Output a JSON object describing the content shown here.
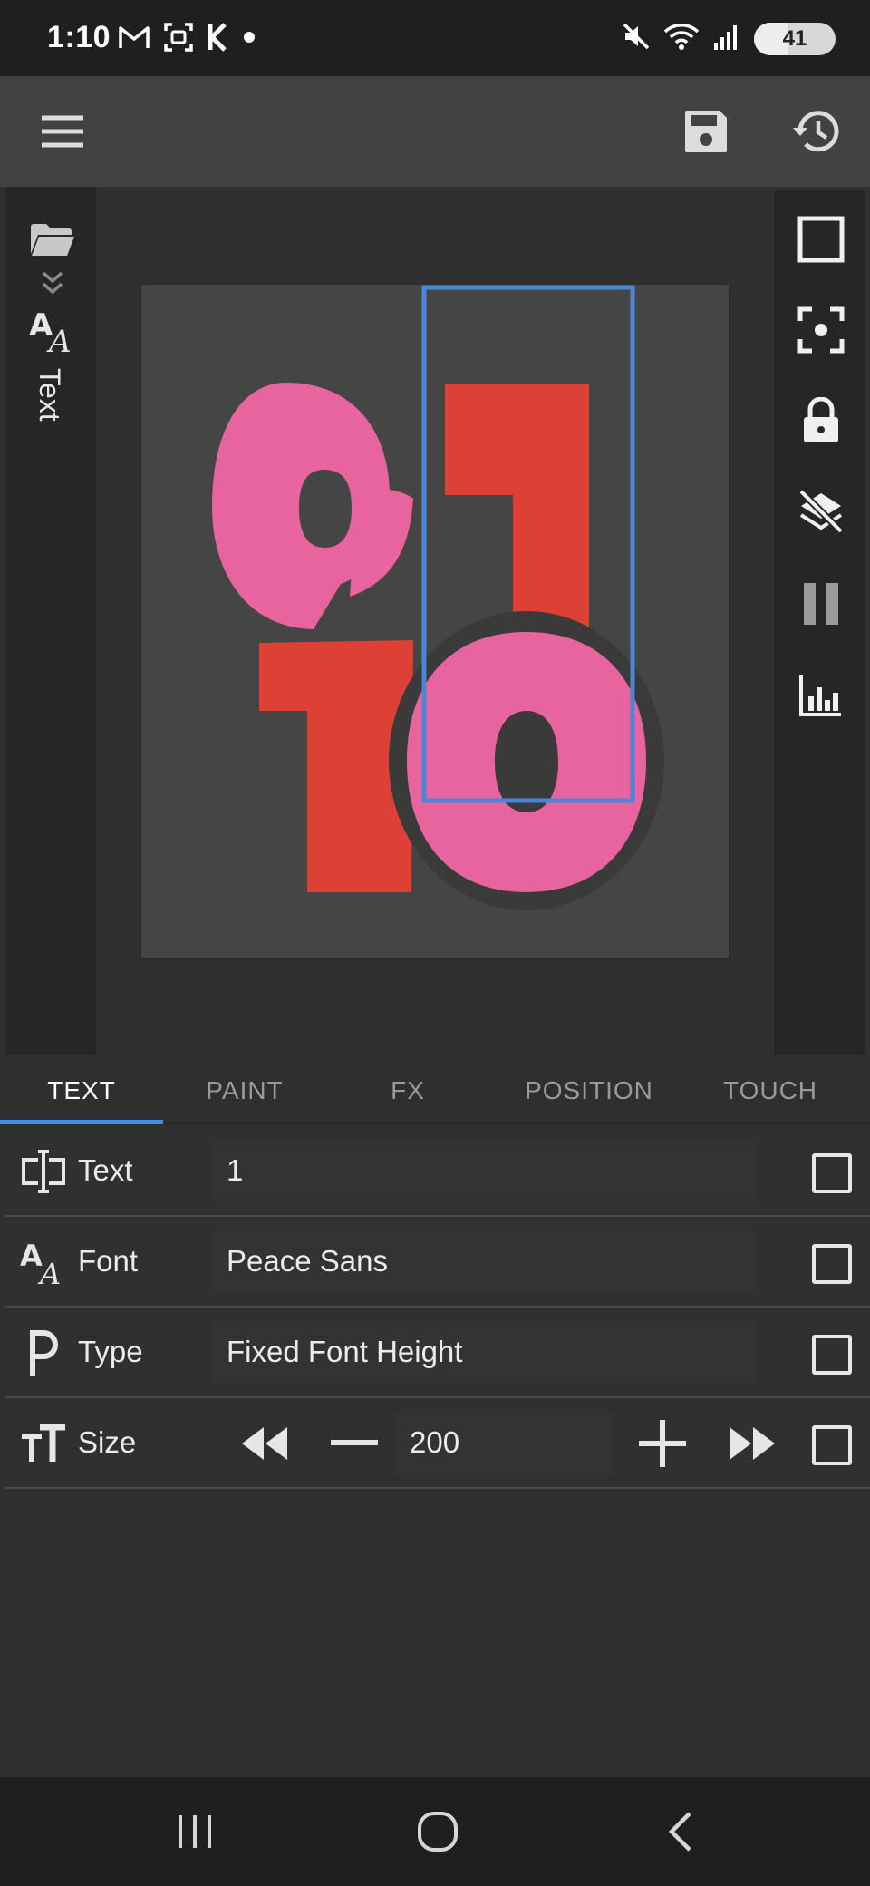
{
  "status_bar": {
    "time": "1:10",
    "battery": "41",
    "battery_level": 0.41,
    "left_icons": [
      "gmail-icon",
      "screenshot-icon",
      "k-app-icon",
      "dot-icon"
    ],
    "right_icons": [
      "mute-icon",
      "wifi-icon",
      "signal-icon",
      "battery-icon"
    ]
  },
  "app_bar": {
    "icons": [
      "menu-icon",
      "save-icon",
      "history-icon"
    ]
  },
  "left_rail": {
    "label": "Text",
    "icons": [
      "folder-icon",
      "chevron-double-down-icon",
      "font-icon"
    ]
  },
  "right_rail": {
    "icons": [
      "square-icon",
      "focus-icon",
      "lock-icon",
      "layers-off-icon",
      "pause-icon",
      "chart-icon"
    ]
  },
  "canvas": {
    "glyphs": [
      "0",
      "1",
      "1",
      "0"
    ],
    "colors": {
      "pink": "#e8649e",
      "red": "#dd4035",
      "background": "#454545",
      "selection": "#4a86d8"
    }
  },
  "tabs": [
    "TEXT",
    "PAINT",
    "FX",
    "POSITION",
    "TOUCH"
  ],
  "active_tab": "TEXT",
  "properties": {
    "text": {
      "label": "Text",
      "value": "1"
    },
    "font": {
      "label": "Font",
      "value": "Peace Sans"
    },
    "type": {
      "label": "Type",
      "value": "Fixed Font Height"
    },
    "size": {
      "label": "Size",
      "value": "200"
    }
  },
  "nav_bar": {
    "icons": [
      "recents-icon",
      "home-icon",
      "back-icon"
    ]
  },
  "colors": {
    "accent": "#3d8ee8",
    "background": "#303030",
    "panel": "#262626",
    "app_bar": "#424242"
  }
}
